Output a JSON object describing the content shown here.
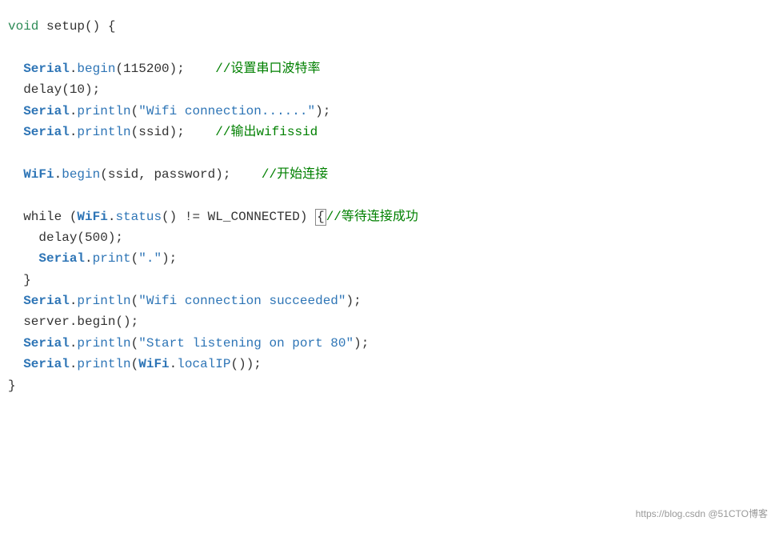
{
  "code": {
    "title": "void setup() {",
    "lines": [
      {
        "id": "line-void-setup",
        "text": "void setup() {",
        "type": "header"
      },
      {
        "id": "line-blank1",
        "text": "",
        "type": "blank"
      },
      {
        "id": "line-serial-begin",
        "text": "  Serial.begin(115200);    //设置串口波特率",
        "type": "code"
      },
      {
        "id": "line-delay1",
        "text": "  delay(10);",
        "type": "code"
      },
      {
        "id": "line-serial-println1",
        "text": "  Serial.println(\"Wifi connection......\");",
        "type": "code"
      },
      {
        "id": "line-serial-println2",
        "text": "  Serial.println(ssid);    //输出wifissid",
        "type": "code"
      },
      {
        "id": "line-blank2",
        "text": "",
        "type": "blank"
      },
      {
        "id": "line-wifi-begin",
        "text": "  WiFi.begin(ssid, password);    //开始连接",
        "type": "code"
      },
      {
        "id": "line-blank3",
        "text": "",
        "type": "blank"
      },
      {
        "id": "line-while",
        "text": "  while (WiFi.status() != WL_CONNECTED) {//等待连接成功",
        "type": "code"
      },
      {
        "id": "line-delay2",
        "text": "    delay(500);",
        "type": "code"
      },
      {
        "id": "line-serial-print",
        "text": "    Serial.print(\".\");",
        "type": "code"
      },
      {
        "id": "line-close-while",
        "text": "  }",
        "type": "code"
      },
      {
        "id": "line-serial-succeeded",
        "text": "  Serial.println(\"Wifi connection succeeded\");",
        "type": "code"
      },
      {
        "id": "line-server-begin",
        "text": "  server.begin();",
        "type": "code"
      },
      {
        "id": "line-serial-port",
        "text": "  Serial.println(\"Start listening on port 80\");",
        "type": "code"
      },
      {
        "id": "line-serial-localip",
        "text": "  Serial.println(WiFi.localIP());",
        "type": "code"
      },
      {
        "id": "line-close-setup",
        "text": "}",
        "type": "code"
      }
    ]
  },
  "watermark": "https://blog.csdn @51CTO博客"
}
